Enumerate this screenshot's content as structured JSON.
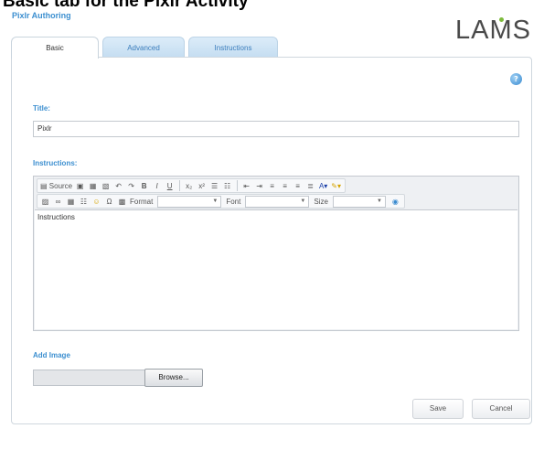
{
  "page_heading": "Basic tab for the Pixlr Activity",
  "app": {
    "title": "Pixlr Authoring",
    "logo_pre": "LA",
    "logo_dot": "M",
    "logo_post": "S"
  },
  "tabs": [
    {
      "label": "Basic",
      "active": true
    },
    {
      "label": "Advanced",
      "active": false
    },
    {
      "label": "Instructions",
      "active": false
    }
  ],
  "help_icon": "?",
  "form": {
    "title_label": "Title:",
    "title_value": "Pixlr",
    "instructions_label": "Instructions:",
    "editor_text": "Instructions",
    "toolbar": {
      "source_label": "Source",
      "format_label": "Format",
      "font_label": "Font",
      "size_label": "Size"
    },
    "add_image_label": "Add Image",
    "browse_label": "Browse..."
  },
  "actions": {
    "save_label": "Save",
    "cancel_label": "Cancel"
  }
}
